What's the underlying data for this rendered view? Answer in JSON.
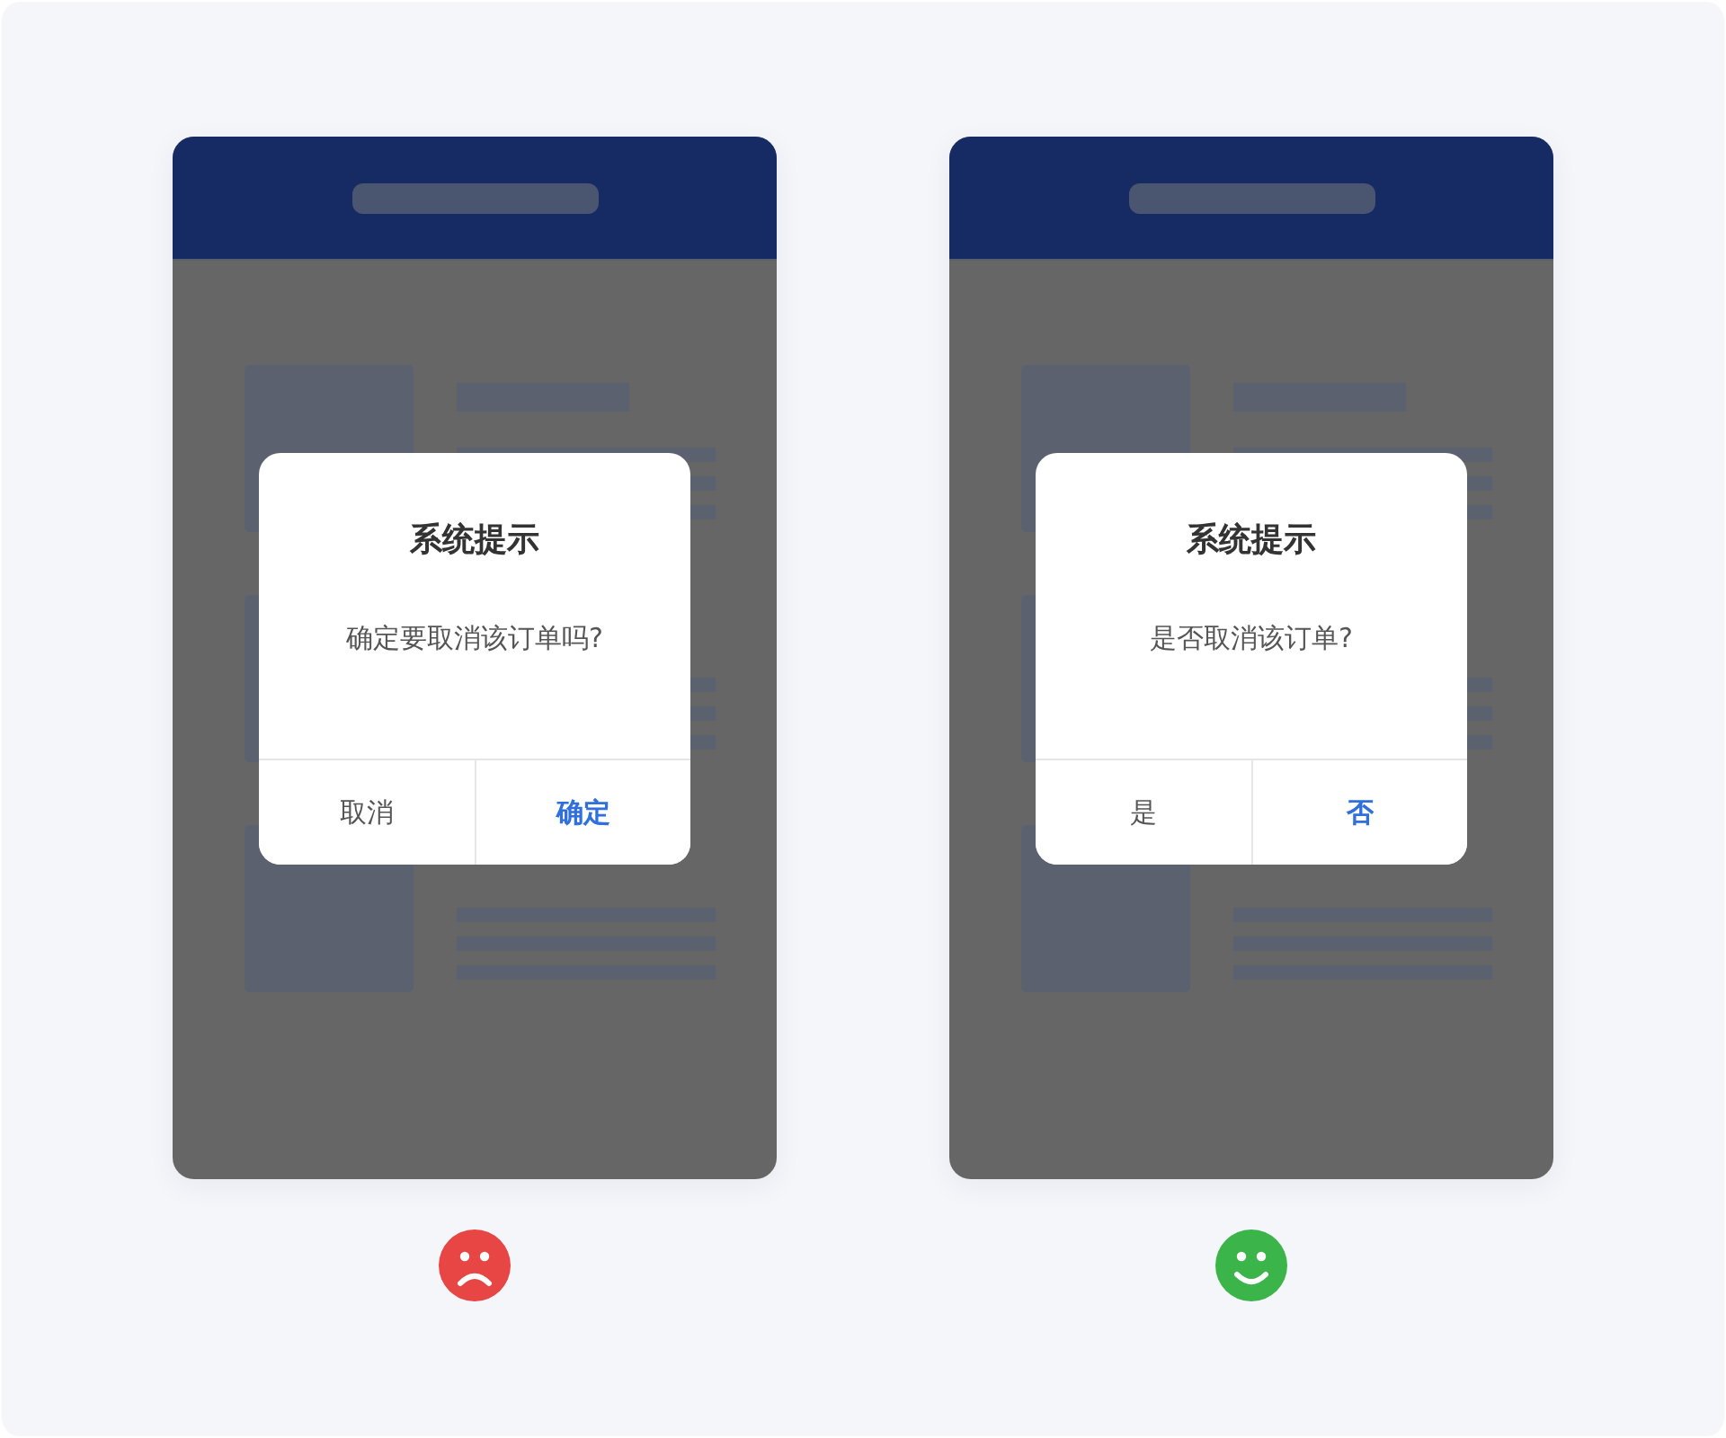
{
  "examples": [
    {
      "dialog": {
        "title": "系统提示",
        "message": "确定要取消该订单吗?",
        "buttons": [
          {
            "label": "取消",
            "primary": false
          },
          {
            "label": "确定",
            "primary": true
          }
        ]
      },
      "verdict": {
        "kind": "sad",
        "color": "#e84545"
      }
    },
    {
      "dialog": {
        "title": "系统提示",
        "message": "是否取消该订单?",
        "buttons": [
          {
            "label": "是",
            "primary": false
          },
          {
            "label": "否",
            "primary": true
          }
        ]
      },
      "verdict": {
        "kind": "happy",
        "color": "#3bb54a"
      }
    }
  ]
}
